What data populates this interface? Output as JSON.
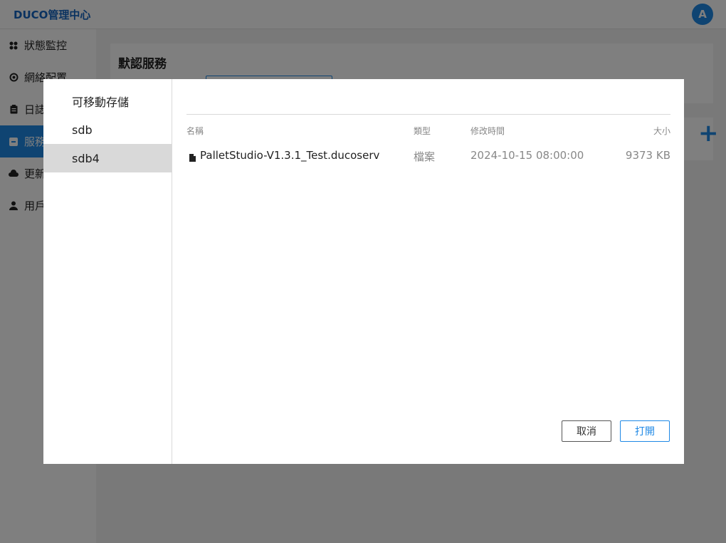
{
  "app": {
    "brand": "DUCO管理中心",
    "avatar_letter": "A"
  },
  "sidebar": {
    "items": [
      {
        "label": "狀態監控",
        "icon": "grid-icon"
      },
      {
        "label": "網絡配置",
        "icon": "target-icon"
      },
      {
        "label": "日誌",
        "icon": "clipboard-icon"
      },
      {
        "label": "服務",
        "icon": "service-icon",
        "active": true
      },
      {
        "label": "更新",
        "icon": "cloud-icon"
      },
      {
        "label": "用戶",
        "icon": "user-icon"
      }
    ]
  },
  "main": {
    "card_title": "默認服務"
  },
  "dialog": {
    "locations": [
      "可移動存儲",
      "sdb",
      "sdb4"
    ],
    "selected_location": "sdb4",
    "columns": {
      "name": "名稱",
      "type": "類型",
      "time": "修改時間",
      "size": "大小"
    },
    "files": [
      {
        "name": "PalletStudio-V1.3.1_Test.ducoserv",
        "type": "檔案",
        "time": "2024-10-15 08:00:00",
        "size": "9373 KB"
      }
    ],
    "cancel_label": "取消",
    "open_label": "打開"
  },
  "colors": {
    "accent": "#1e88e5",
    "brand": "#1565c0"
  }
}
